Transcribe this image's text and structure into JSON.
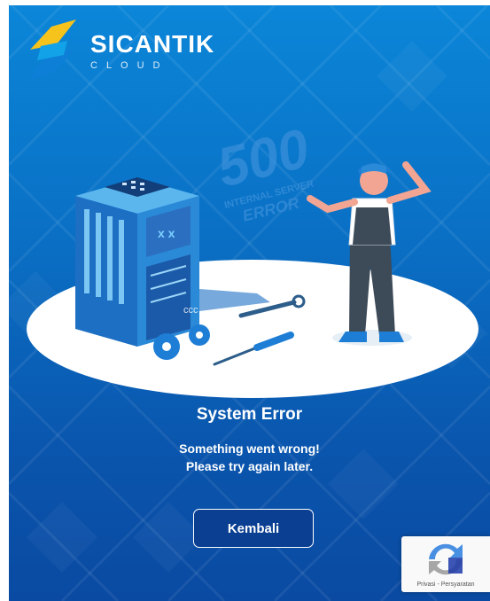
{
  "brand": {
    "name": "SICANTIK",
    "sub": "CLOUD"
  },
  "illustration": {
    "code": "500",
    "caption_line1": "INTERNAL SERVER",
    "caption_line2": "ERROR",
    "watermark": "ccc"
  },
  "error": {
    "title": "System Error",
    "message_line1": "Something went wrong!",
    "message_line2": "Please try again later."
  },
  "actions": {
    "back_label": "Kembali"
  },
  "recaptcha": {
    "privacy": "Privasi",
    "separator": "-",
    "terms": "Persyaratan"
  },
  "colors": {
    "bg_top": "#0b86d8",
    "bg_bottom": "#0a4aa2",
    "button_bg": "#0a3f92",
    "logo_yellow": "#f6c21c",
    "logo_blue": "#0e7fd6"
  }
}
